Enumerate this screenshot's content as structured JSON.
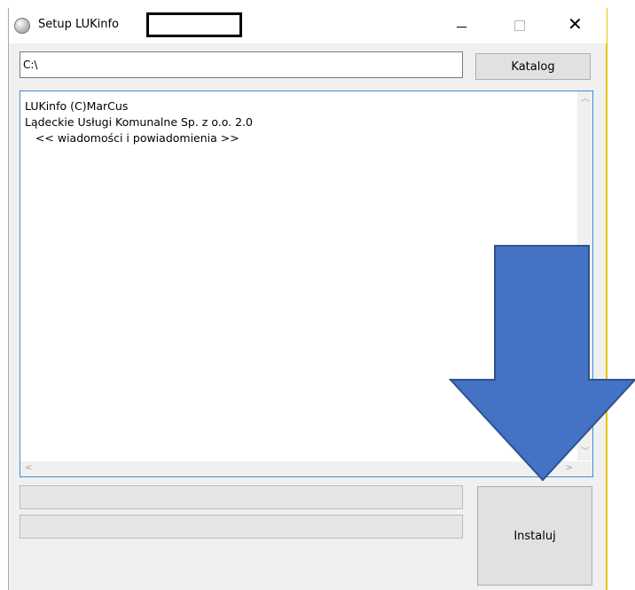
{
  "window": {
    "title": "Setup LUKinfo"
  },
  "path": {
    "value": "C:\\"
  },
  "buttons": {
    "katalog": "Katalog",
    "instaluj": "Instaluj"
  },
  "text_area": {
    "lines": [
      "LUKinfo (C)MarCus",
      "",
      "Lądeckie Usługi Komunalne Sp. z o.o. 2.0",
      "   << wiadomości i powiadomienia >>"
    ]
  },
  "progress": {
    "bar_1": 0,
    "bar_2": 0
  },
  "colors": {
    "annotation_arrow": "#4472c4",
    "annotation_arrow_border": "#2f528f",
    "focus_border": "#3c8fd8"
  },
  "icons": {
    "app": "cd-disc-icon",
    "minimize": "minimize-icon",
    "maximize": "maximize-icon",
    "close": "close-icon"
  }
}
